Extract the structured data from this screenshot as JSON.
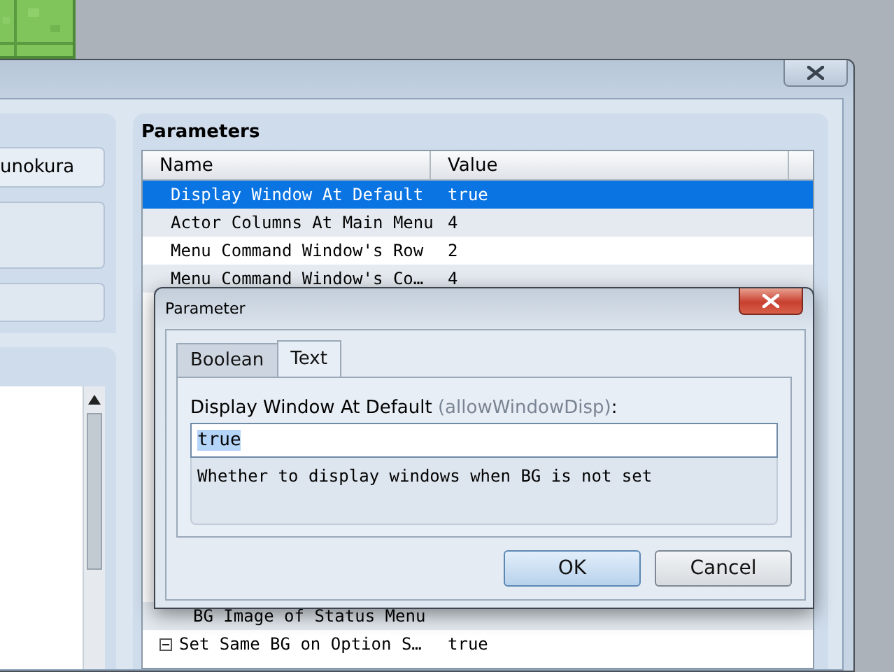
{
  "left_panel": {
    "field_value": "unokura"
  },
  "parameters": {
    "title": "Parameters",
    "columns": [
      "Name",
      "Value"
    ],
    "rows": [
      {
        "name": "Display Window At Default",
        "value": "true",
        "selected": true
      },
      {
        "name": "Actor Columns At Main Menu",
        "value": "4",
        "selected": false
      },
      {
        "name": "Menu Command Window's Row",
        "value": "2",
        "selected": false
      },
      {
        "name": "Menu Command Window's Co…",
        "value": "4",
        "selected": false
      }
    ],
    "rows_below": [
      {
        "children": [
          {
            "name": "BG Image of Status Menu",
            "selected": false
          }
        ]
      },
      {
        "name": "Set Same BG on Option S…",
        "value": "true",
        "selected": false,
        "expanded": true
      }
    ]
  },
  "dialog": {
    "title": "Parameter",
    "tabs": [
      {
        "label": "Boolean",
        "selected": false
      },
      {
        "label": "Text",
        "selected": true
      }
    ],
    "field_label": "Display Window At Default",
    "field_key": "(allowWindowDisp)",
    "field_suffix": ":",
    "value": "true",
    "description": "Whether to display windows when BG is not set",
    "buttons": [
      {
        "label": "OK",
        "default": true
      },
      {
        "label": "Cancel",
        "default": false
      }
    ]
  }
}
